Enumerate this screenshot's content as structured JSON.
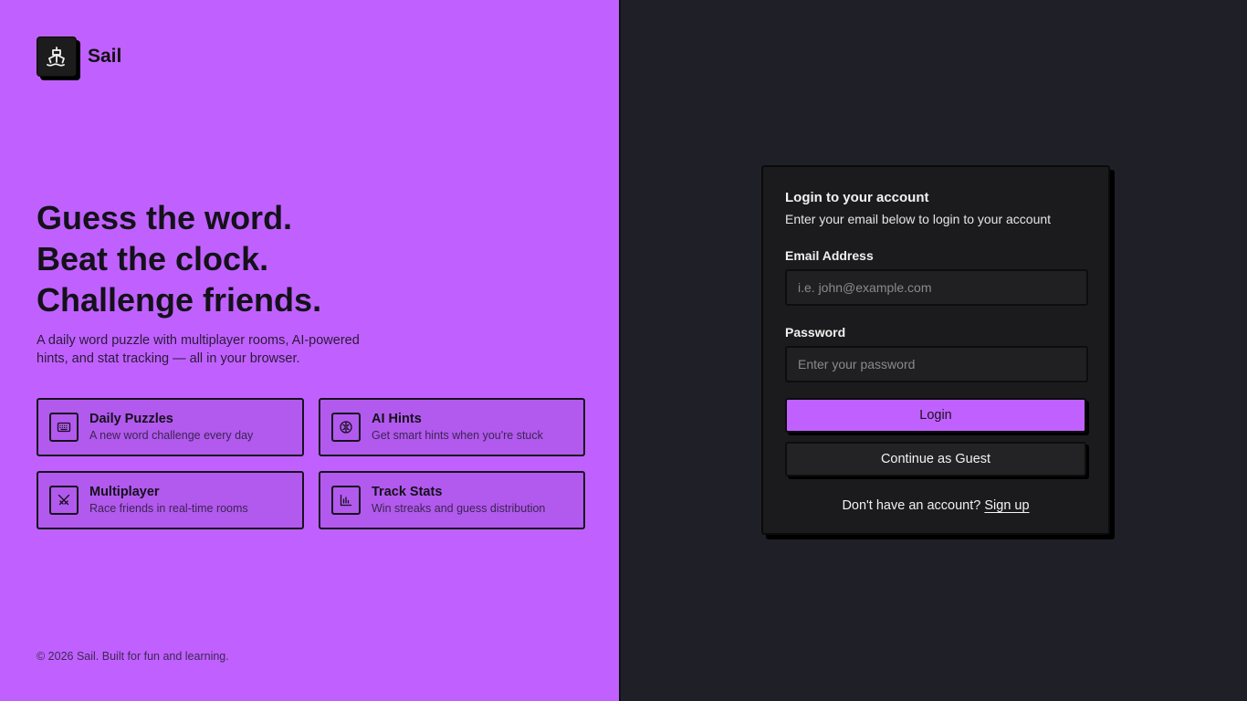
{
  "brand": {
    "name": "Sail"
  },
  "hero": {
    "headline": [
      "Guess the word.",
      "Beat the clock.",
      "Challenge friends."
    ],
    "subtext": "A daily word puzzle with multiplayer rooms, AI-powered hints, and stat tracking — all in your browser."
  },
  "features": [
    {
      "icon": "keyboard-icon",
      "title": "Daily Puzzles",
      "desc": "A new word challenge every day"
    },
    {
      "icon": "brain-icon",
      "title": "AI Hints",
      "desc": "Get smart hints when you're stuck"
    },
    {
      "icon": "swords-icon",
      "title": "Multiplayer",
      "desc": "Race friends in real-time rooms"
    },
    {
      "icon": "bar-chart-icon",
      "title": "Track Stats",
      "desc": "Win streaks and guess distribution"
    }
  ],
  "footer": "© 2026 Sail. Built for fun and learning.",
  "login": {
    "title": "Login to your account",
    "subtitle": "Enter your email below to login to your account",
    "email_label": "Email Address",
    "email_placeholder": "i.e. john@example.com",
    "email_value": "",
    "password_label": "Password",
    "password_placeholder": "Enter your password",
    "password_value": "",
    "login_button": "Login",
    "guest_button": "Continue as Guest",
    "signup_prompt": "Don't have an account?",
    "signup_link": "Sign up"
  },
  "colors": {
    "accent": "#c061ff",
    "dark_panel": "#1f2027",
    "card": "#1b1b1d"
  }
}
